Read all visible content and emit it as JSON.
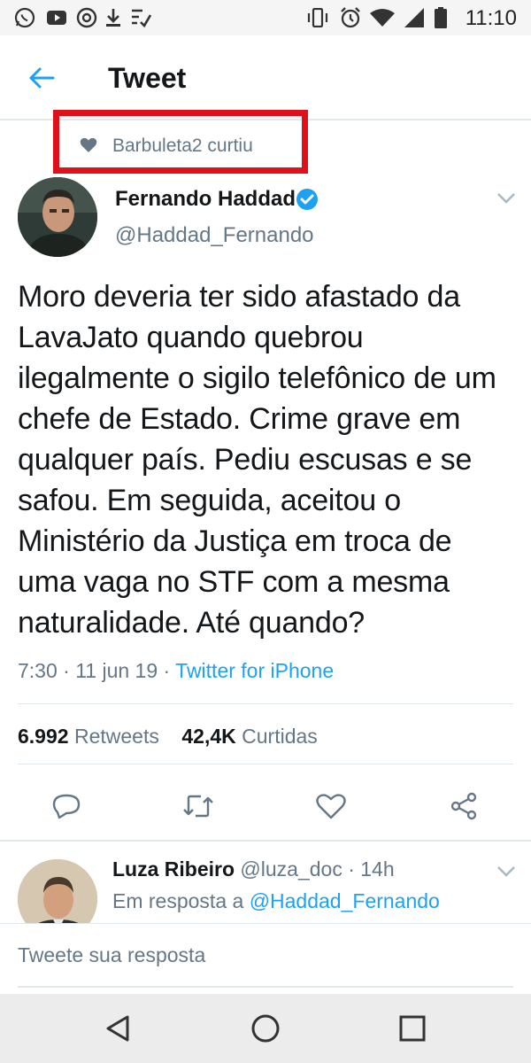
{
  "status_bar": {
    "time": "11:10",
    "left_icons": [
      "whatsapp-icon",
      "youtube-icon",
      "chrome-icon",
      "download-icon",
      "checklist-icon"
    ],
    "right_icons": [
      "vibrate-icon",
      "alarm-icon",
      "wifi-icon",
      "signal-icon",
      "battery-icon"
    ]
  },
  "header": {
    "title": "Tweet",
    "back_icon": "arrow-left-icon",
    "accent": "#1da1f2"
  },
  "social_context": {
    "text": "Barbuleta2 curtiu",
    "icon": "heart-icon",
    "highlight_color": "#e0101a"
  },
  "tweet": {
    "author_name": "Fernando Haddad",
    "author_handle": "@Haddad_Fernando",
    "verified": true,
    "text": "Moro deveria ter sido afastado da LavaJato quando quebrou ilegalmente o sigilo telefônico de um chefe de Estado. Crime grave em qualquer país. Pediu escusas e se safou. Em seguida, aceitou o Ministério da Justiça em troca de uma vaga no STF com a mesma naturalidade. Até quando?",
    "timestamp": "7:30 · 11 jun 19 · ",
    "source": "Twitter for iPhone",
    "retweets_count": "6.992",
    "retweets_label": "Retweets",
    "likes_count": "42,4K",
    "likes_label": "Curtidas"
  },
  "actions": [
    "reply-icon",
    "retweet-icon",
    "like-icon",
    "share-icon"
  ],
  "reply": {
    "author_name": "Luza Ribeiro",
    "author_handle": "@luza_doc",
    "time": " · 14h",
    "replying_to_prefix": "Em resposta a ",
    "replying_to_handle": "@Haddad_Fernando"
  },
  "compose": {
    "placeholder": "Tweete sua resposta"
  },
  "navigation": [
    "back-triangle-icon",
    "home-circle-icon",
    "recents-square-icon"
  ]
}
